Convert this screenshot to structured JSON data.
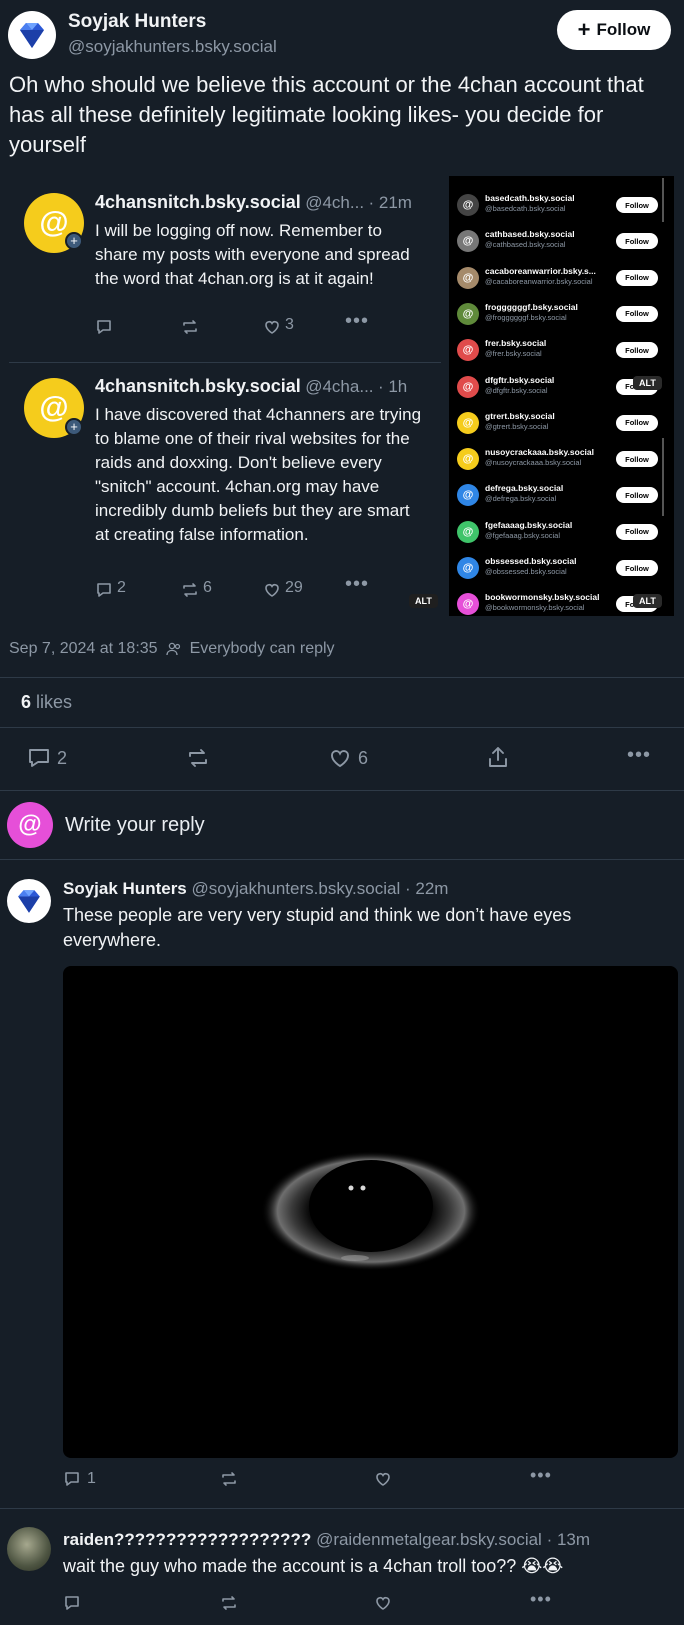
{
  "author": {
    "name": "Soyjak Hunters",
    "handle": "@soyjakhunters.bsky.social",
    "follow_label": "Follow"
  },
  "post": {
    "text": "Oh who should we believe this account or the 4chan account that has all these definitely legitimate looking likes- you decide for yourself",
    "timestamp": "Sep 7, 2024 at 18:35",
    "reply_setting": "Everybody can reply",
    "likes_count": "6",
    "likes_label": "likes",
    "actions": {
      "replies": "2",
      "likes": "6"
    }
  },
  "embed_posts": [
    {
      "name": "4chansnitch.bsky.social",
      "handle": "@4ch...",
      "time": "· 21m",
      "body": "I will be logging off now. Remember to share my posts with everyone and spread the word that 4chan.org is at it again!",
      "replies": "",
      "reposts": "",
      "likes": "3"
    },
    {
      "name": "4chansnitch.bsky.social",
      "handle": "@4cha...",
      "time": "· 1h",
      "body": "I have discovered that 4channers are trying to blame one of their rival websites for the raids and doxxing. Don't believe every \"snitch\" account. 4chan.org may have incredibly dumb beliefs but they are smart at creating false information.",
      "replies": "2",
      "reposts": "6",
      "likes": "29"
    }
  ],
  "embed_alt": "ALT",
  "follow_list": [
    {
      "name": "basedcath.bsky.social",
      "handle": "@basedcath.bsky.social",
      "button": "Follow",
      "color": "#444"
    },
    {
      "name": "cathbased.bsky.social",
      "handle": "@cathbased.bsky.social",
      "button": "Follow",
      "color": "#777"
    },
    {
      "name": "cacaboreanwarrior.bsky.s...",
      "handle": "@cacaboreanwarrior.bsky.social",
      "button": "Follow",
      "color": "#a58a6a"
    },
    {
      "name": "froggggggf.bsky.social",
      "handle": "@froggggggf.bsky.social",
      "button": "Follow",
      "color": "#5f8a3a"
    },
    {
      "name": "frer.bsky.social",
      "handle": "@frer.bsky.social",
      "button": "Follow",
      "color": "#e04b4b"
    },
    {
      "name": "dfgftr.bsky.social",
      "handle": "@dfgftr.bsky.social",
      "button": "Follow",
      "color": "#e04b4b"
    },
    {
      "name": "gtrert.bsky.social",
      "handle": "@gtrert.bsky.social",
      "button": "Follow",
      "color": "#f5cc1c"
    },
    {
      "name": "nusoycrackaaa.bsky.social",
      "handle": "@nusoycrackaaa.bsky.social",
      "button": "Follow",
      "color": "#f5cc1c"
    },
    {
      "name": "defrega.bsky.social",
      "handle": "@defrega.bsky.social",
      "button": "Follow",
      "color": "#2f86e6"
    },
    {
      "name": "fgefaaaag.bsky.social",
      "handle": "@fgefaaag.bsky.social",
      "button": "Follow",
      "color": "#3fc46a"
    },
    {
      "name": "obssessed.bsky.social",
      "handle": "@obssessed.bsky.social",
      "button": "Follow",
      "color": "#2f86e6"
    },
    {
      "name": "bookwormonsky.bsky.social",
      "handle": "@bookwormonsky.bsky.social",
      "button": "Follow",
      "color": "#e64fd8"
    }
  ],
  "reply_box": {
    "placeholder": "Write your reply"
  },
  "replies": [
    {
      "name": "Soyjak Hunters",
      "handle": "@soyjakhunters.bsky.social",
      "time": "· 22m",
      "body": "These people are very very stupid and think we don’t have eyes everywhere.",
      "replies": "1"
    },
    {
      "name": "raiden???????????????????",
      "handle": "@raidenmetalgear.bsky.social",
      "time": "· 13m",
      "body": "wait the guy who made the account is a 4chan troll too?? 😭😭"
    }
  ]
}
